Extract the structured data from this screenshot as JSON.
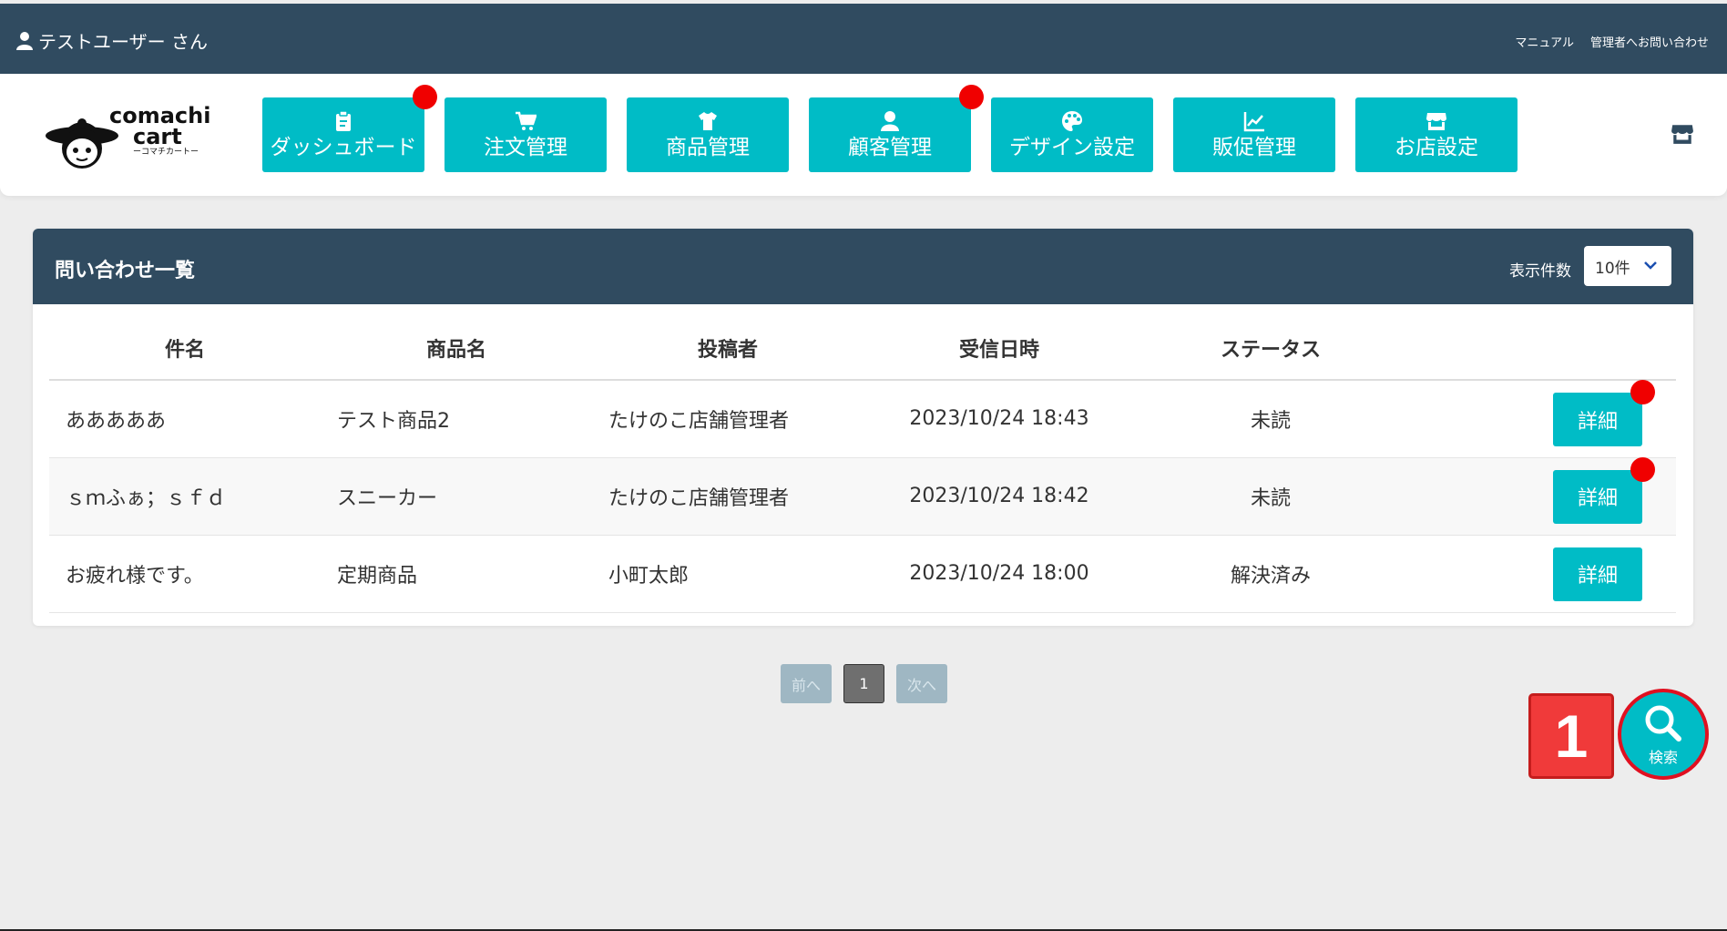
{
  "header": {
    "user_label": "テストユーザー さん",
    "links": [
      "マニュアル",
      "管理者へお問い合わせ"
    ]
  },
  "brand": {
    "line1": "comachi",
    "line2": "cart",
    "line3": "ーコマチカートー"
  },
  "nav": [
    {
      "label": "ダッシュボード",
      "icon": "clipboard-icon",
      "dot": true
    },
    {
      "label": "注文管理",
      "icon": "cart-icon",
      "dot": false
    },
    {
      "label": "商品管理",
      "icon": "tshirt-icon",
      "dot": false
    },
    {
      "label": "顧客管理",
      "icon": "user-icon",
      "dot": true
    },
    {
      "label": "デザイン設定",
      "icon": "palette-icon",
      "dot": false
    },
    {
      "label": "販促管理",
      "icon": "chart-icon",
      "dot": false
    },
    {
      "label": "お店設定",
      "icon": "store-icon",
      "dot": false
    }
  ],
  "panel": {
    "title": "問い合わせ一覧",
    "per_page_label": "表示件数",
    "per_page_value": "10件"
  },
  "table": {
    "headers": [
      "件名",
      "商品名",
      "投稿者",
      "受信日時",
      "ステータス"
    ],
    "rows": [
      {
        "subject": "あああああ",
        "product": "テスト商品2",
        "author": "たけのこ店舗管理者",
        "date": "2023/10/24 18:43",
        "status": "未読",
        "action": "詳細",
        "dot": true
      },
      {
        "subject": "ｓｍふぁ；ｓｆｄ",
        "product": "スニーカー",
        "author": "たけのこ店舗管理者",
        "date": "2023/10/24 18:42",
        "status": "未読",
        "action": "詳細",
        "dot": true
      },
      {
        "subject": "お疲れ様です。",
        "product": "定期商品",
        "author": "小町太郎",
        "date": "2023/10/24 18:00",
        "status": "解決済み",
        "action": "詳細",
        "dot": false
      }
    ]
  },
  "pagination": {
    "prev": "前へ",
    "current": "1",
    "next": "次へ"
  },
  "annotation": {
    "badge": "1"
  },
  "search_fab": {
    "label": "検索"
  },
  "colors": {
    "dark": "#304b60",
    "accent": "#00bcc6",
    "notify": "#f00000"
  }
}
